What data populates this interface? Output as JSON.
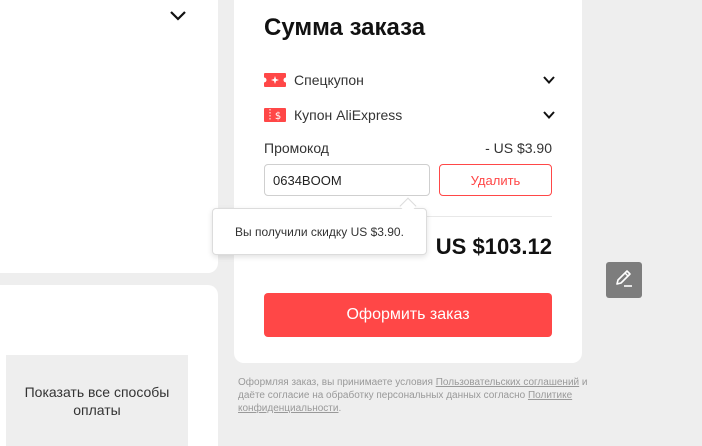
{
  "summary": {
    "title": "Сумма заказа",
    "special_coupon_label": "Спецкупон",
    "ali_coupon_label": "Купон AliExpress",
    "promo_label": "Промокод",
    "promo_discount": "- US $3.90",
    "promo_code_value": "0634BOOM",
    "remove_button_label": "Удалить",
    "total": "US $103.12",
    "order_button_label": "Оформить заказ"
  },
  "tooltip": {
    "text": "Вы получили скидку US $3.90."
  },
  "left": {
    "show_payment_methods_label": "Показать все способы оплаты"
  },
  "legal": {
    "part1": "Оформляя заказ, вы принимаете условия ",
    "link1": "Пользовательских соглашений",
    "part2": " и даёте согласие на обработку персональных данных согласно ",
    "link2": "Политике конфиденциальности",
    "part3": "."
  },
  "colors": {
    "accent": "#ff4747",
    "page_bg": "#eeeeee",
    "edit_button": "#7d7d7d"
  },
  "icons": {
    "special_coupon": "coupon-ticket-icon",
    "ali_coupon": "coupon-dollar-icon",
    "chevron": "chevron-down-icon",
    "edit": "pencil-icon"
  }
}
